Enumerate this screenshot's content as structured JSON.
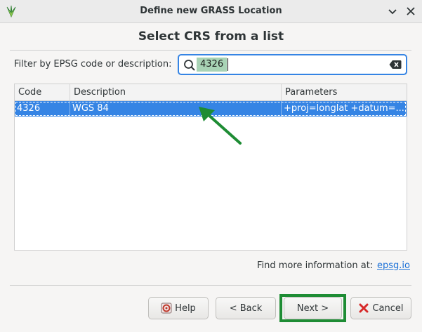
{
  "window": {
    "title": "Define new GRASS Location"
  },
  "page": {
    "heading": "Select CRS from a list"
  },
  "filter": {
    "label": "Filter by EPSG code or description:",
    "value": "4326"
  },
  "table": {
    "headers": [
      "Code",
      "Description",
      "Parameters"
    ],
    "rows": [
      {
        "code": "4326",
        "description": "WGS 84",
        "parameters": "+proj=longlat +datum=..."
      }
    ]
  },
  "info": {
    "text": "Find more information at:",
    "link": "epsg.io"
  },
  "buttons": {
    "help": "Help",
    "back": "< Back",
    "next": "Next >",
    "cancel": "Cancel"
  },
  "colors": {
    "selection": "#3584e4",
    "highlight": "#1e8c34",
    "search_highlight": "#a8d3b5"
  }
}
